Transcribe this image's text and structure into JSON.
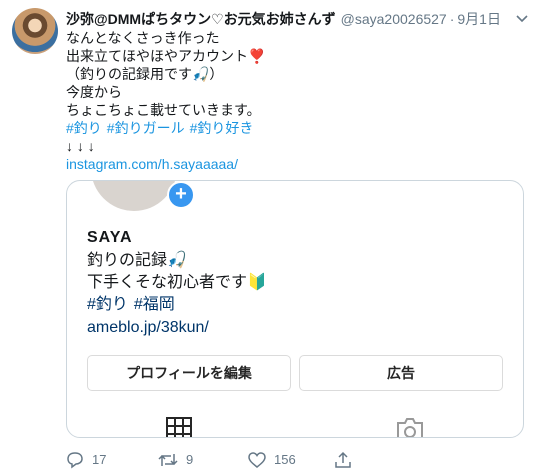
{
  "tweet": {
    "display_name": "沙弥@DMMぱちタウン♡お元気お姉さんず",
    "handle": "@saya20026527",
    "separator": "·",
    "date": "9月1日",
    "lines": [
      "なんとなくさっき作った",
      "出来立てほやほやアカウント❣️",
      "（釣りの記録用です🎣）",
      "今度から",
      "ちょこちょこ載せていきます。"
    ],
    "hashtags": [
      "#釣り",
      "#釣りガール",
      "#釣り好き"
    ],
    "arrows": "↓ ↓ ↓",
    "link": "instagram.com/h.sayaaaaa/"
  },
  "card": {
    "profile_name": "SAYA",
    "bio_line1": "釣りの記録🎣",
    "bio_line2": "下手くそな初心者です🔰",
    "tags": [
      "#釣り",
      "#福岡"
    ],
    "link": "ameblo.jp/38kun/",
    "edit_profile_label": "プロフィールを編集",
    "ads_label": "広告",
    "plus_label": "+"
  },
  "actions": {
    "reply_count": "17",
    "retweet_count": "9",
    "like_count": "156"
  },
  "colors": {
    "link": "#1b95e0",
    "muted": "#657786",
    "border": "#ccd6dd",
    "ig_link": "#003569",
    "ig_blue": "#3897f0"
  },
  "icons": [
    "chevron-down-icon",
    "reply-icon",
    "retweet-icon",
    "like-icon",
    "share-icon",
    "grid-icon",
    "camera-icon"
  ]
}
